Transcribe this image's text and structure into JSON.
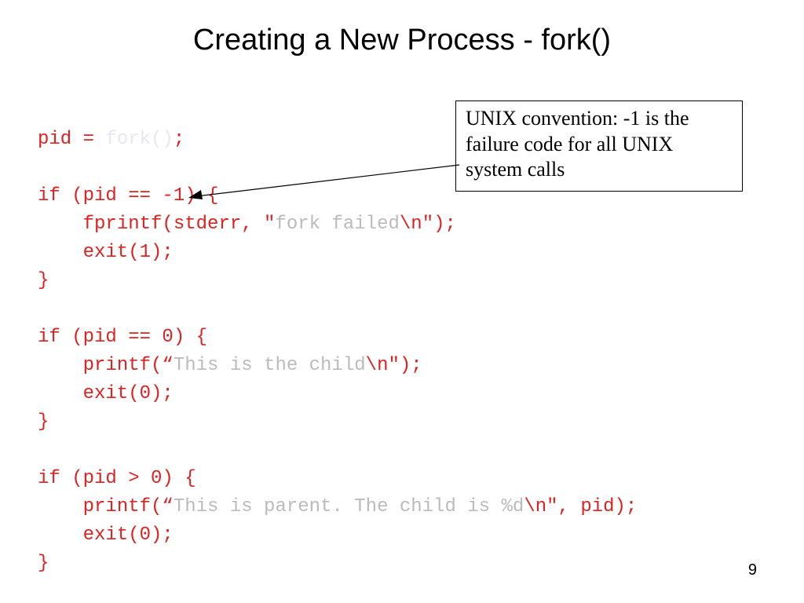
{
  "title": "Creating a New Process  - fork()",
  "callout": "UNIX convention: -1 is the failure code for all UNIX system calls",
  "page_number": "9",
  "code": {
    "l1a": "pid = ",
    "l1b": "fork()",
    "l1c": ";",
    "l2": "if (pid == -1) {",
    "l3a": "    fprintf(stderr, \"",
    "l3b": "fork failed",
    "l3c": "\\n\");",
    "l4": "    exit(1);",
    "l5": "}",
    "l6": "if (pid == 0) {",
    "l7a": "    printf(“",
    "l7b": "This is the child",
    "l7c": "\\n\");",
    "l8": "    exit(0);",
    "l9": "}",
    "l10": "if (pid > 0) {",
    "l11a": "    printf(“",
    "l11b": "This is parent. The child is %d",
    "l11c": "\\n\", pid);",
    "l12": "    exit(0);",
    "l13": "}"
  }
}
